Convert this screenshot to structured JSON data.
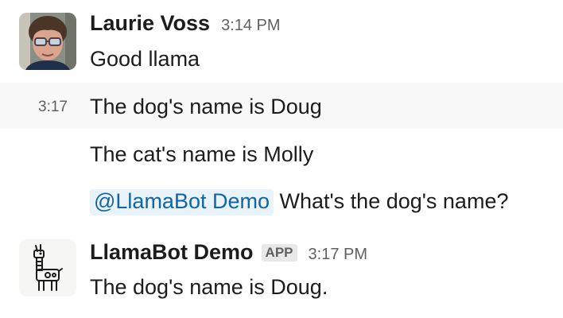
{
  "messages": [
    {
      "sender": "Laurie Voss",
      "time": "3:14 PM",
      "text": "Good llama"
    },
    {
      "side_time": "3:17",
      "text": "The dog's name is Doug"
    },
    {
      "text": "The cat's name is Molly"
    },
    {
      "mention": "@LlamaBot Demo",
      "text": " What's the dog's name?"
    },
    {
      "sender": "LlamaBot Demo",
      "badge": "APP",
      "time": "3:17 PM",
      "text": "The dog's name is Doug."
    }
  ],
  "colors": {
    "mention_text": "#1264a3",
    "mention_bg": "#e8f3fc",
    "muted": "#616061",
    "text": "#1d1c1d",
    "hover_row": "#f8f8f8"
  },
  "icons": {
    "laurie_avatar": "user-photo-avatar",
    "llamabot_avatar": "llama-robot-avatar"
  }
}
